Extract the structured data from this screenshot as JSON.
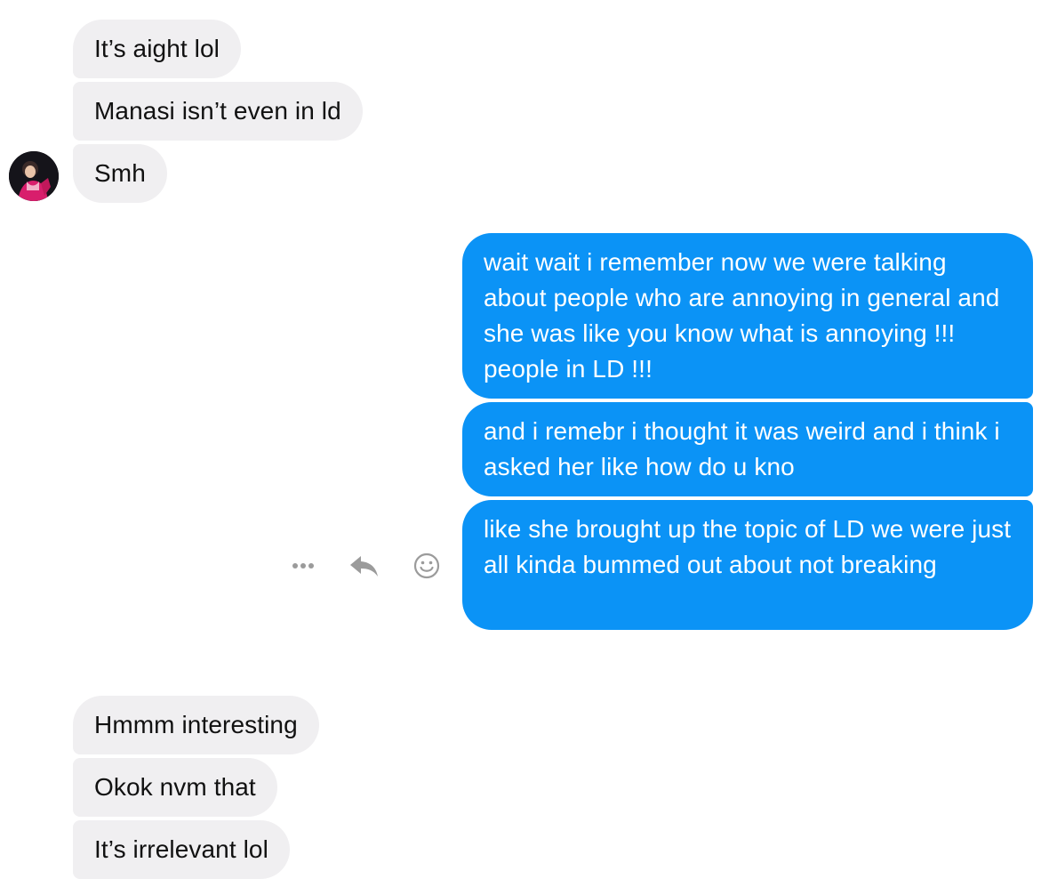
{
  "thread": {
    "contact_avatar": "contact-profile-photo",
    "incoming_group_1": [
      {
        "text": "It’s aight lol"
      },
      {
        "text": "Manasi isn’t even in ld"
      },
      {
        "text": "Smh"
      }
    ],
    "outgoing_group": [
      {
        "text": "wait wait i remember now we were talking about people who are annoying in general and she was like you know what is annoying !!! people in LD !!!"
      },
      {
        "text": "and i remebr i thought it was weird and i think i asked her like how do u kno"
      },
      {
        "text": "like she brought up the topic of LD we were just all kinda bummed out about not breaking"
      }
    ],
    "incoming_group_2": [
      {
        "text": "Hmmm interesting"
      },
      {
        "text": "Okok nvm that"
      },
      {
        "text": "It’s irrelevant lol"
      }
    ]
  },
  "message_actions": {
    "more": "more-options-icon",
    "reply": "reply-icon",
    "react": "emoji-react-icon"
  },
  "colors": {
    "incoming_bubble": "#f0eff1",
    "outgoing_bubble": "#0b93f6",
    "icon_gray": "#9b9b9b"
  }
}
